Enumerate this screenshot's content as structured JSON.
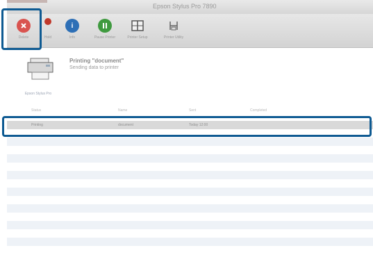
{
  "window": {
    "title": "Epson Stylus Pro 7890"
  },
  "toolbar": {
    "items": [
      {
        "label": "Delete",
        "icon": "delete-icon",
        "color": "#d9534f"
      },
      {
        "label": "Hold",
        "icon": "hold-icon",
        "color": "#c0392b"
      },
      {
        "label": "Info",
        "icon": "info-icon",
        "color": "#2d6fb6"
      },
      {
        "label": "Pause Printer",
        "icon": "pause-icon",
        "color": "#3f9a3f"
      },
      {
        "label": "Printer Setup",
        "icon": "settings-icon",
        "color": "#555555"
      },
      {
        "label": "Printer Utility",
        "icon": "utility-icon",
        "color": "#666666"
      }
    ]
  },
  "printer": {
    "caption": "Epson Stylus Pro",
    "status_title": "Printing \"document\"",
    "status_subtitle": "Sending data to printer"
  },
  "table": {
    "columns": [
      "Status",
      "Name",
      "Sent",
      "Completed"
    ],
    "rows": [
      {
        "status": "Printing",
        "name": "document",
        "sent": "Today 12:00",
        "completed": ""
      }
    ]
  },
  "colors": {
    "highlight": "#0e5a92",
    "selected_row": "#d9d9d9",
    "stripe": "#eef2f7"
  }
}
